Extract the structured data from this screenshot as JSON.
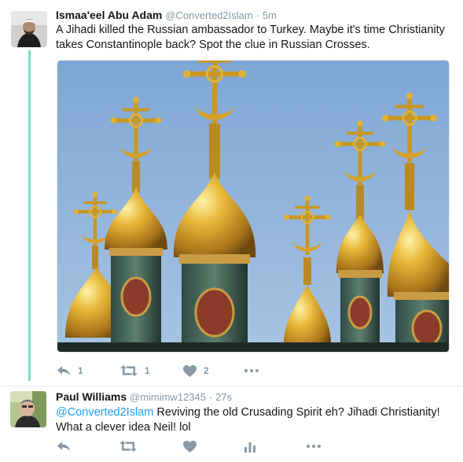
{
  "tweets": [
    {
      "name": "Ismaa'eel Abu Adam",
      "handle": "@Converted2Islam",
      "separator": "·",
      "time": "5m",
      "text": "A Jihadi killed the Russian ambassador to Turkey. Maybe it's time Christianity takes Constantinople back? Spot the clue in Russian Crosses.",
      "avatar_icon": "avatar-photo",
      "actions": {
        "reply": "1",
        "retweet": "1",
        "like": "2"
      }
    },
    {
      "name": "Paul Williams",
      "handle": "@mimimw12345",
      "separator": "·",
      "time": "27s",
      "mention": "@Converted2Islam",
      "text": " Reviving the old Crusading Spirit eh? Jihadi Christianity! What a clever idea Neil! lol",
      "avatar_icon": "avatar-photo",
      "actions": {
        "reply": "",
        "retweet": "",
        "like": ""
      }
    }
  ],
  "colors": {
    "thread_line": "#7fdcc7",
    "icon_gray": "#8899a6",
    "link": "#1da1f2",
    "sky": "#8fb2d7",
    "gold": "#d9a627"
  }
}
